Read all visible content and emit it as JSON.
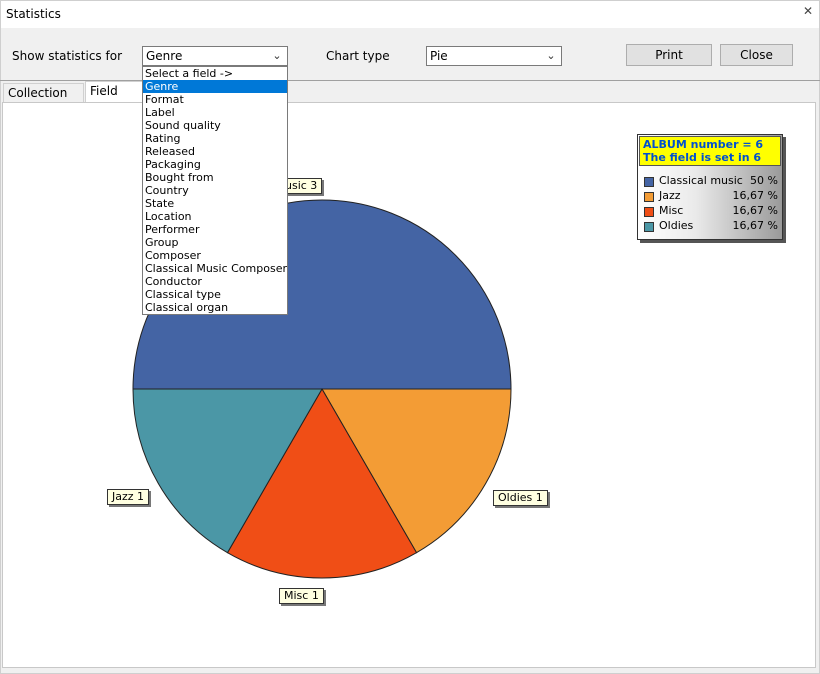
{
  "window": {
    "title": "Statistics"
  },
  "toolbar": {
    "show_label": "Show statistics for",
    "field_value": "Genre",
    "chart_type_label": "Chart type",
    "chart_type_value": "Pie",
    "print_label": "Print",
    "close_label": "Close"
  },
  "tabs": [
    {
      "label": "Collection data"
    },
    {
      "label": "Field chart"
    }
  ],
  "dropdown": {
    "items": [
      "Select a field ->",
      "Genre",
      "Format",
      "Label",
      "Sound quality",
      "Rating",
      "Released",
      "Packaging",
      "Bought from",
      "Country",
      "State",
      "Location",
      "Performer",
      "Group",
      "Composer",
      "Classical Music Composer",
      "Conductor",
      "Classical type",
      "Classical organ"
    ],
    "selected_index": 1
  },
  "legend": {
    "line1": "ALBUM number = 6",
    "line2": "The field is set in 6",
    "rows": [
      {
        "name": "Classical music",
        "pct": "50 %",
        "color": "#4464a4"
      },
      {
        "name": "Jazz",
        "pct": "16,67 %",
        "color": "#f39c35"
      },
      {
        "name": "Misc",
        "pct": "16,67 %",
        "color": "#f04e16"
      },
      {
        "name": "Oldies",
        "pct": "16,67 %",
        "color": "#4b97a6"
      }
    ]
  },
  "chart_data": {
    "type": "pie",
    "categories": [
      "Classical music",
      "Jazz",
      "Misc",
      "Oldies"
    ],
    "values": [
      3,
      1,
      1,
      1
    ],
    "colors": [
      "#4464a4",
      "#f39c35",
      "#f04e16",
      "#4b97a6"
    ],
    "slice_labels": [
      "usic 3",
      "Jazz 1",
      "Misc 1",
      "Oldies 1"
    ]
  }
}
